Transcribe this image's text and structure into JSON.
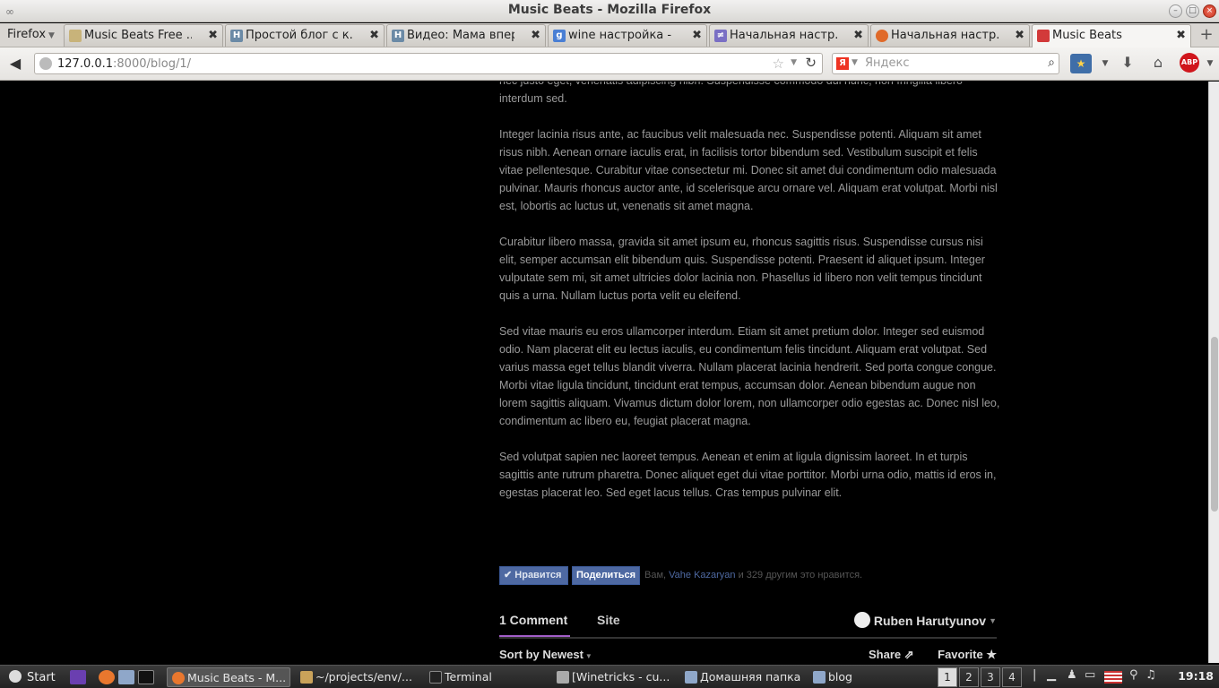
{
  "window": {
    "title": "Music Beats - Mozilla Firefox"
  },
  "firefox_menu": "Firefox",
  "tabs": [
    {
      "label": "Music Beats Free ...",
      "icon_color": "#c8b37a",
      "icon_text": ""
    },
    {
      "label": "Простой блог с к...",
      "icon_color": "#6b8aa6",
      "icon_text": "H"
    },
    {
      "label": "Видео: Мама впер...",
      "icon_color": "#6b8aa6",
      "icon_text": "H"
    },
    {
      "label": "wine настройка - ...",
      "icon_color": "#4a7fd4",
      "icon_text": "g"
    },
    {
      "label": "Начальная настр...",
      "icon_color": "#7a6fc4",
      "icon_text": "≠"
    },
    {
      "label": "Начальная настр...",
      "icon_color": "#e06a2a",
      "icon_text": ""
    },
    {
      "label": "Music Beats",
      "icon_color": "#d23a3a",
      "icon_text": ""
    }
  ],
  "url": {
    "host": "127.0.0.1",
    "rest": ":8000/blog/1/"
  },
  "search": {
    "placeholder": "Яндекс",
    "engine_letter": "Я"
  },
  "article": {
    "paragraphs": [
      "nec justo eget, venenatis adipiscing nibh. Suspendisse commodo dui nunc, non fringilla libero interdum sed.",
      "Integer lacinia risus ante, ac faucibus velit malesuada nec. Suspendisse potenti. Aliquam sit amet risus nibh. Aenean ornare iaculis erat, in facilisis tortor bibendum sed. Vestibulum suscipit et felis vitae pellentesque. Curabitur vitae consectetur mi. Donec sit amet dui condimentum odio malesuada pulvinar. Mauris rhoncus auctor ante, id scelerisque arcu ornare vel. Aliquam erat volutpat. Morbi nisl est, lobortis ac luctus ut, venenatis sit amet magna.",
      "Curabitur libero massa, gravida sit amet ipsum eu, rhoncus sagittis risus. Suspendisse cursus nisi elit, semper accumsan elit bibendum quis. Suspendisse potenti. Praesent id aliquet ipsum. Integer vulputate sem mi, sit amet ultricies dolor lacinia non. Phasellus id libero non velit tempus tincidunt quis a urna. Nullam luctus porta velit eu eleifend.",
      "Sed vitae mauris eu eros ullamcorper interdum. Etiam sit amet pretium dolor. Integer sed euismod odio. Nam placerat elit eu lectus iaculis, eu condimentum felis tincidunt. Aliquam erat volutpat. Sed varius massa eget tellus blandit viverra. Nullam placerat lacinia hendrerit. Sed porta congue congue. Morbi vitae ligula tincidunt, tincidunt erat tempus, accumsan dolor. Aenean bibendum augue non lorem sagittis aliquam. Vivamus dictum dolor lorem, non ullamcorper odio egestas ac. Donec nisl leo, condimentum ac libero eu, feugiat placerat magna.",
      "Sed volutpat sapien nec laoreet tempus. Aenean et enim at ligula dignissim laoreet. In et turpis sagittis ante rutrum pharetra. Donec aliquet eget dui vitae porttitor. Morbi urna odio, mattis id eros in, egestas placerat leo. Sed eget lacus tellus. Cras tempus pulvinar elit."
    ]
  },
  "social": {
    "like_label": "Нравится",
    "share_label": "Поделиться",
    "text_before": "Вам, ",
    "friend_name": "Vahe Kazaryan",
    "text_after": " и 329 другим это нравится."
  },
  "comments": {
    "count_label": "1 Comment",
    "site_label": "Site",
    "user_name": "Ruben Harutyunov",
    "sort_label": "Sort by Newest",
    "share_label": "Share",
    "favorite_label": "Favorite"
  },
  "taskbar": {
    "start_label": "Start",
    "tasks": [
      {
        "label": "Music Beats - M...",
        "icon_color": "#e8772e"
      },
      {
        "label": "~/projects/env/...",
        "icon_color": "#c9a25a"
      },
      {
        "label": "Terminal",
        "icon_color": "#222222"
      },
      {
        "label": "[Winetricks - cu...",
        "icon_color": "#aaaaaa"
      },
      {
        "label": "Домашняя папка",
        "icon_color": "#8fa7c9"
      },
      {
        "label": "blog",
        "icon_color": "#8fa7c9"
      }
    ],
    "workspaces": [
      "1",
      "2",
      "3",
      "4"
    ],
    "active_workspace": "1",
    "clock": "19:18"
  }
}
